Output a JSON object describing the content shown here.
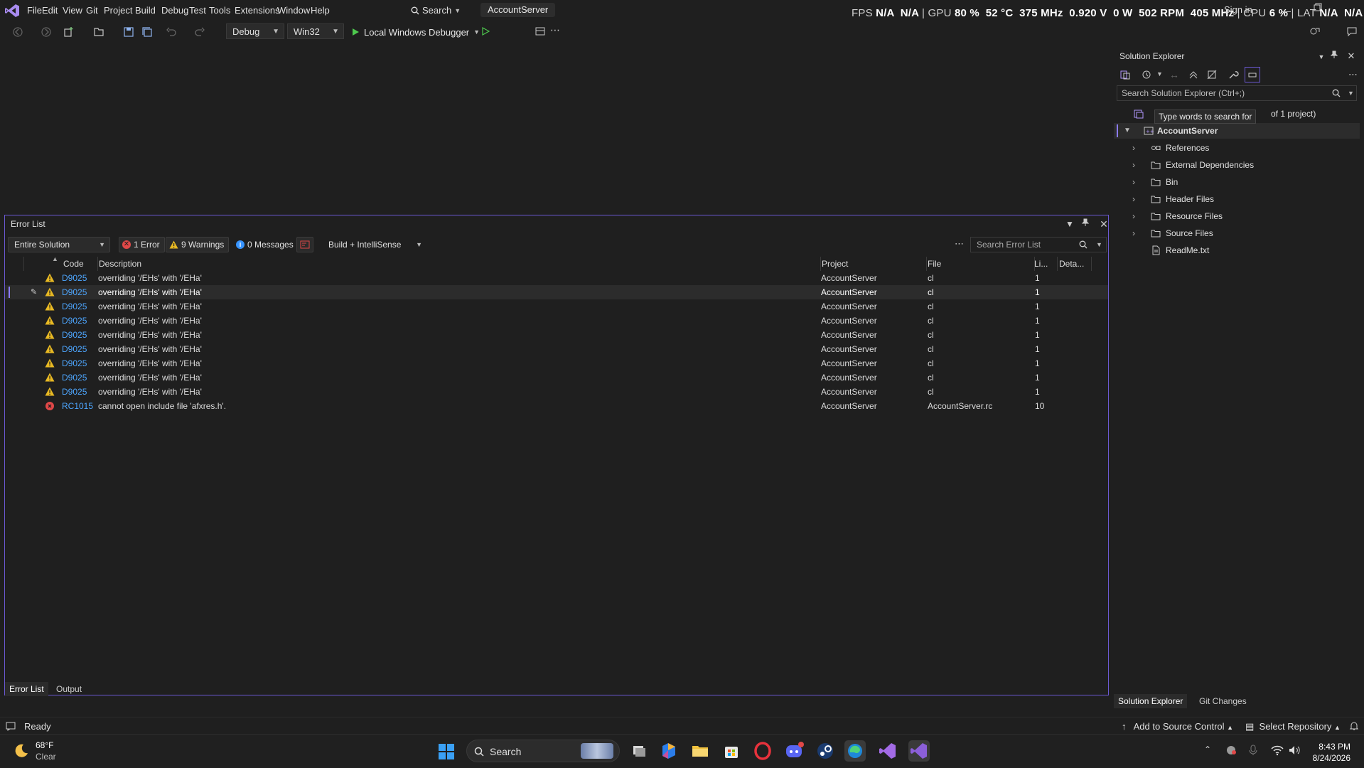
{
  "menu": {
    "items": [
      "File",
      "Edit",
      "View",
      "Git",
      "Project",
      "Build",
      "Debug",
      "Test",
      "Tools",
      "Extensions",
      "Window",
      "Help"
    ],
    "search_label": "Search",
    "solution_name": "AccountServer"
  },
  "perf_overlay": {
    "fps_label": "FPS",
    "fps_values": "N/A  N/A",
    "gpu_label": "GPU",
    "gpu_values": "80 %  52 °C  375 MHz  0.920 V  0 W  502 RPM  405 MHz",
    "cpu_label": "CPU",
    "cpu_value": "6 %",
    "lat_label": "LAT",
    "lat_values": "N/A  N/A"
  },
  "signin_label": "Sign in",
  "toolbar": {
    "config": "Debug",
    "platform": "Win32",
    "debugger": "Local Windows Debugger"
  },
  "error_list": {
    "title": "Error List",
    "scope": "Entire Solution",
    "errors_label": "1 Error",
    "warnings_label": "9 Warnings",
    "messages_label": "0 Messages",
    "source_filter": "Build + IntelliSense",
    "search_placeholder": "Search Error List",
    "columns": {
      "code": "Code",
      "description": "Description",
      "project": "Project",
      "file": "File",
      "line": "Li...",
      "details": "Deta..."
    },
    "rows": [
      {
        "type": "warning",
        "code": "D9025",
        "description": "overriding '/EHs' with '/EHa'",
        "project": "AccountServer",
        "file": "cl",
        "line": "1"
      },
      {
        "type": "warning",
        "code": "D9025",
        "description": "overriding '/EHs' with '/EHa'",
        "project": "AccountServer",
        "file": "cl",
        "line": "1"
      },
      {
        "type": "warning",
        "code": "D9025",
        "description": "overriding '/EHs' with '/EHa'",
        "project": "AccountServer",
        "file": "cl",
        "line": "1"
      },
      {
        "type": "warning",
        "code": "D9025",
        "description": "overriding '/EHs' with '/EHa'",
        "project": "AccountServer",
        "file": "cl",
        "line": "1"
      },
      {
        "type": "warning",
        "code": "D9025",
        "description": "overriding '/EHs' with '/EHa'",
        "project": "AccountServer",
        "file": "cl",
        "line": "1"
      },
      {
        "type": "warning",
        "code": "D9025",
        "description": "overriding '/EHs' with '/EHa'",
        "project": "AccountServer",
        "file": "cl",
        "line": "1"
      },
      {
        "type": "warning",
        "code": "D9025",
        "description": "overriding '/EHs' with '/EHa'",
        "project": "AccountServer",
        "file": "cl",
        "line": "1"
      },
      {
        "type": "warning",
        "code": "D9025",
        "description": "overriding '/EHs' with '/EHa'",
        "project": "AccountServer",
        "file": "cl",
        "line": "1"
      },
      {
        "type": "warning",
        "code": "D9025",
        "description": "overriding '/EHs' with '/EHa'",
        "project": "AccountServer",
        "file": "cl",
        "line": "1"
      },
      {
        "type": "error",
        "code": "RC1015",
        "description": "cannot open include file 'afxres.h'.",
        "project": "AccountServer",
        "file": "AccountServer.rc",
        "line": "10"
      }
    ],
    "tabs": [
      "Error List",
      "Output"
    ]
  },
  "solution_explorer": {
    "title": "Solution Explorer",
    "search_placeholder": "Search Solution Explorer (Ctrl+;)",
    "solution_line_suffix": "of 1 project)",
    "tooltip": "Type words to search for",
    "project": "AccountServer",
    "nodes": [
      "References",
      "External Dependencies",
      "Bin",
      "Header Files",
      "Resource Files",
      "Source Files",
      "ReadMe.txt"
    ],
    "tabs": [
      "Solution Explorer",
      "Git Changes"
    ]
  },
  "statusbar": {
    "ready": "Ready",
    "add_source_control": "Add to Source Control",
    "select_repository": "Select Repository"
  },
  "taskbar": {
    "weather_temp": "68°F",
    "weather_cond": "Clear",
    "search_label": "Search",
    "time": "8:43 PM",
    "date": "8/24/2026"
  },
  "colors": {
    "accent": "#6b59d3",
    "link": "#4da6ff",
    "error": "#e04848",
    "warning": "#e8b923"
  }
}
